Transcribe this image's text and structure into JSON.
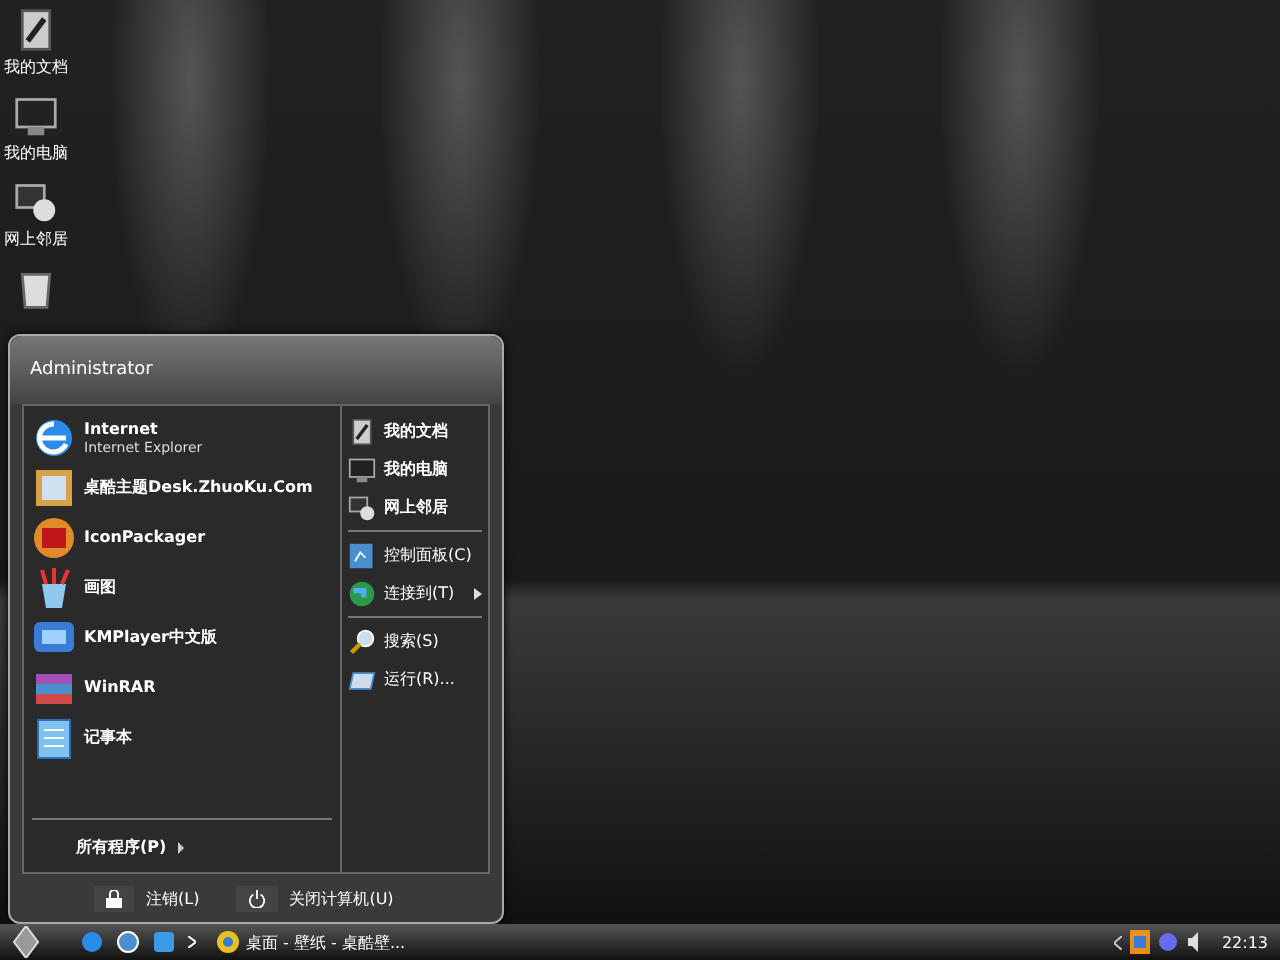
{
  "desktop_icons": [
    {
      "label": "我的文档"
    },
    {
      "label": "我的电脑"
    },
    {
      "label": "网上邻居"
    }
  ],
  "start_menu": {
    "user": "Administrator",
    "programs": [
      {
        "title": "Internet",
        "subtitle": "Internet Explorer"
      },
      {
        "title": "桌酷主题Desk.ZhuoKu.Com"
      },
      {
        "title": "IconPackager"
      },
      {
        "title": "画图"
      },
      {
        "title": "KMPlayer中文版"
      },
      {
        "title": "WinRAR"
      },
      {
        "title": "记事本"
      }
    ],
    "all_programs": "所有程序(P)",
    "places": [
      {
        "label": "我的文档",
        "kind": "bold"
      },
      {
        "label": "我的电脑",
        "kind": "bold"
      },
      {
        "label": "网上邻居",
        "kind": "bold"
      },
      {
        "kind": "separator"
      },
      {
        "label": "控制面板(C)",
        "kind": "item",
        "submenu": false
      },
      {
        "label": "连接到(T)",
        "kind": "item",
        "submenu": true
      },
      {
        "kind": "separator"
      },
      {
        "label": "搜索(S)",
        "kind": "item",
        "submenu": false
      },
      {
        "label": "运行(R)...",
        "kind": "item",
        "submenu": false
      }
    ],
    "logoff": "注销(L)",
    "shutdown": "关闭计算机(U)"
  },
  "taskbar": {
    "tasks": [
      {
        "label": "桌面 - 壁纸 - 桌酷壁..."
      }
    ],
    "clock": "22:13"
  }
}
